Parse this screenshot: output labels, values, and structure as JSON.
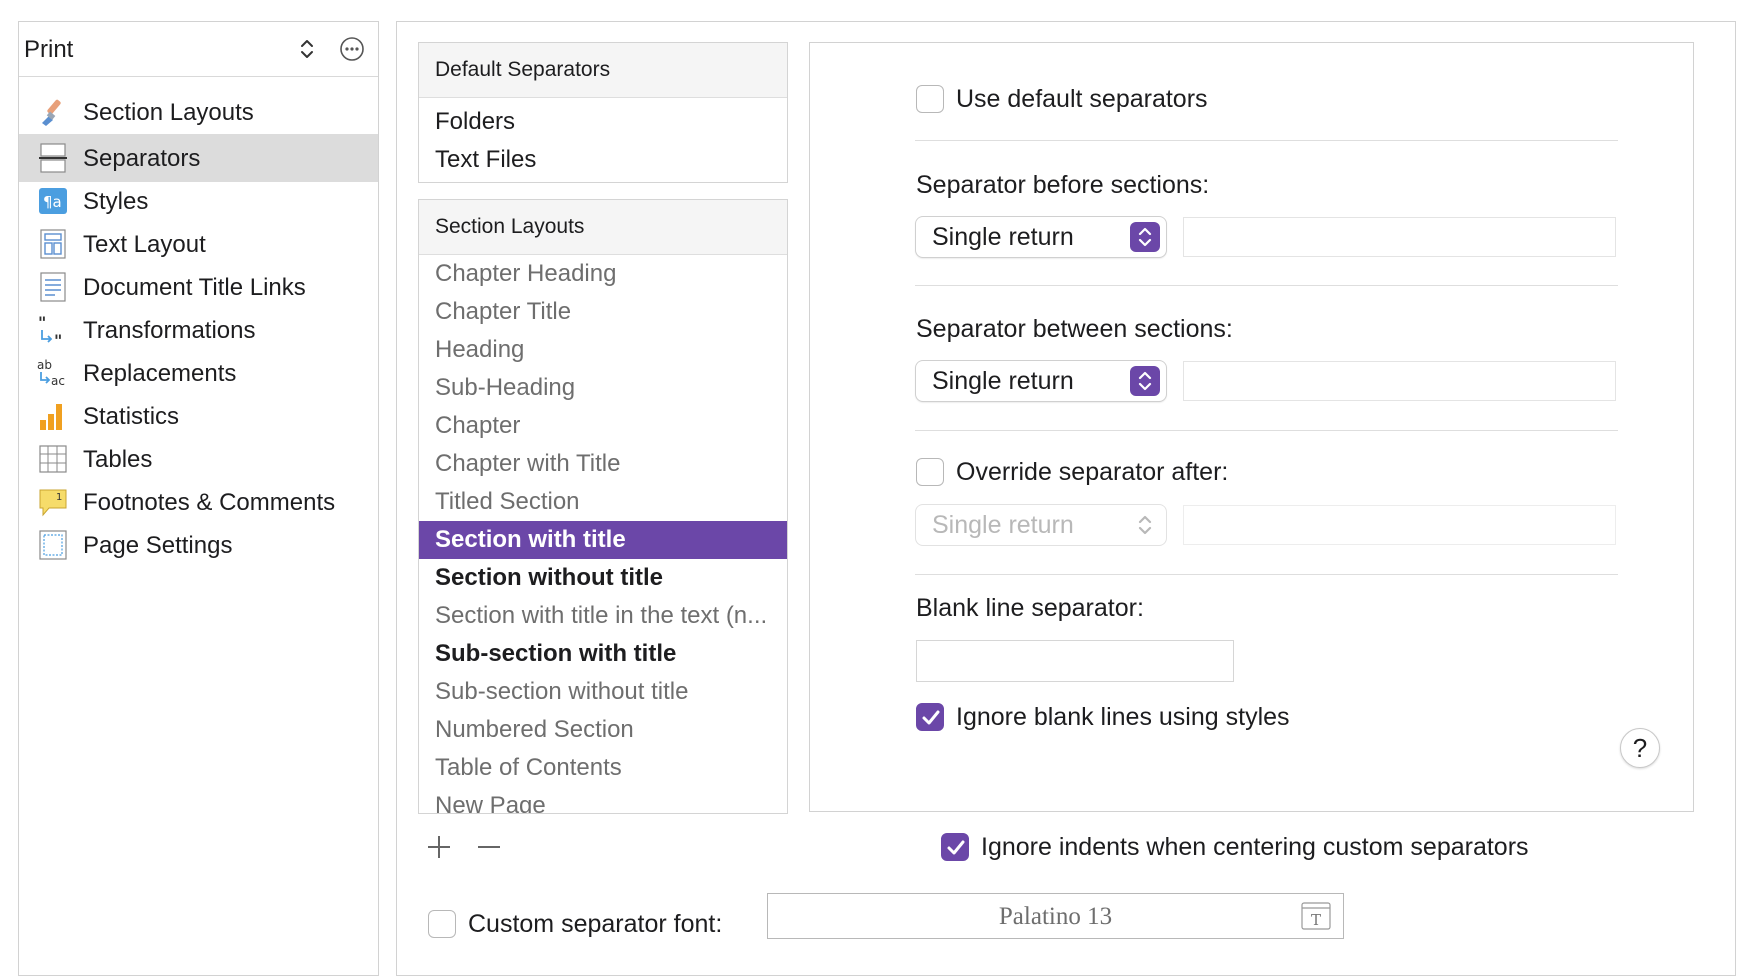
{
  "sidebar": {
    "format_name": "Print",
    "items": [
      {
        "label": "Section Layouts",
        "icon": "paintbrush-icon"
      },
      {
        "label": "Separators",
        "icon": "separator-icon"
      },
      {
        "label": "Styles",
        "icon": "styles-icon"
      },
      {
        "label": "Text Layout",
        "icon": "text-layout-icon"
      },
      {
        "label": "Document Title Links",
        "icon": "document-icon"
      },
      {
        "label": "Transformations",
        "icon": "quotes-transform-icon"
      },
      {
        "label": "Replacements",
        "icon": "replace-icon"
      },
      {
        "label": "Statistics",
        "icon": "bar-chart-icon"
      },
      {
        "label": "Tables",
        "icon": "table-icon"
      },
      {
        "label": "Footnotes & Comments",
        "icon": "footnote-icon"
      },
      {
        "label": "Page Settings",
        "icon": "page-settings-icon"
      }
    ],
    "selected": "Separators"
  },
  "default_separators": {
    "header": "Default Separators",
    "items": [
      "Folders",
      "Text Files"
    ]
  },
  "section_layouts": {
    "header": "Section Layouts",
    "items": [
      {
        "label": "Chapter Heading",
        "style": "light"
      },
      {
        "label": "Chapter Title",
        "style": "light"
      },
      {
        "label": "Heading",
        "style": "light"
      },
      {
        "label": "Sub-Heading",
        "style": "light"
      },
      {
        "label": "Chapter",
        "style": "light"
      },
      {
        "label": "Chapter with Title",
        "style": "light"
      },
      {
        "label": "Titled Section",
        "style": "light"
      },
      {
        "label": "Section with title",
        "style": "selected"
      },
      {
        "label": "Section without title",
        "style": "bold"
      },
      {
        "label": "Section with title in the text (n...",
        "style": "light"
      },
      {
        "label": "Sub-section with title",
        "style": "bold"
      },
      {
        "label": "Sub-section without title",
        "style": "light"
      },
      {
        "label": "Numbered Section",
        "style": "light"
      },
      {
        "label": "Table of Contents",
        "style": "light"
      },
      {
        "label": "New Page",
        "style": "light"
      }
    ]
  },
  "list_buttons": {
    "add": "+",
    "remove": "—"
  },
  "options": {
    "use_default": {
      "label": "Use default separators",
      "checked": false
    },
    "before": {
      "label": "Separator before sections:",
      "value": "Single return",
      "custom_text": ""
    },
    "between": {
      "label": "Separator between sections:",
      "value": "Single return",
      "custom_text": ""
    },
    "override_after": {
      "label": "Override separator after:",
      "checked": false,
      "value": "Single return",
      "custom_text": ""
    },
    "blank_line": {
      "label": "Blank line separator:",
      "value": ""
    },
    "ignore_blank_lines": {
      "label": "Ignore blank lines using styles",
      "checked": true
    },
    "help": "?"
  },
  "ignore_indents": {
    "label": "Ignore indents when centering custom separators",
    "checked": true
  },
  "custom_font": {
    "label": "Custom separator font:",
    "checked": false,
    "value": "Palatino 13"
  },
  "colors": {
    "accent": "#6b47a8",
    "selection_text": "#ffffff",
    "muted_text": "#6e6e6e"
  }
}
